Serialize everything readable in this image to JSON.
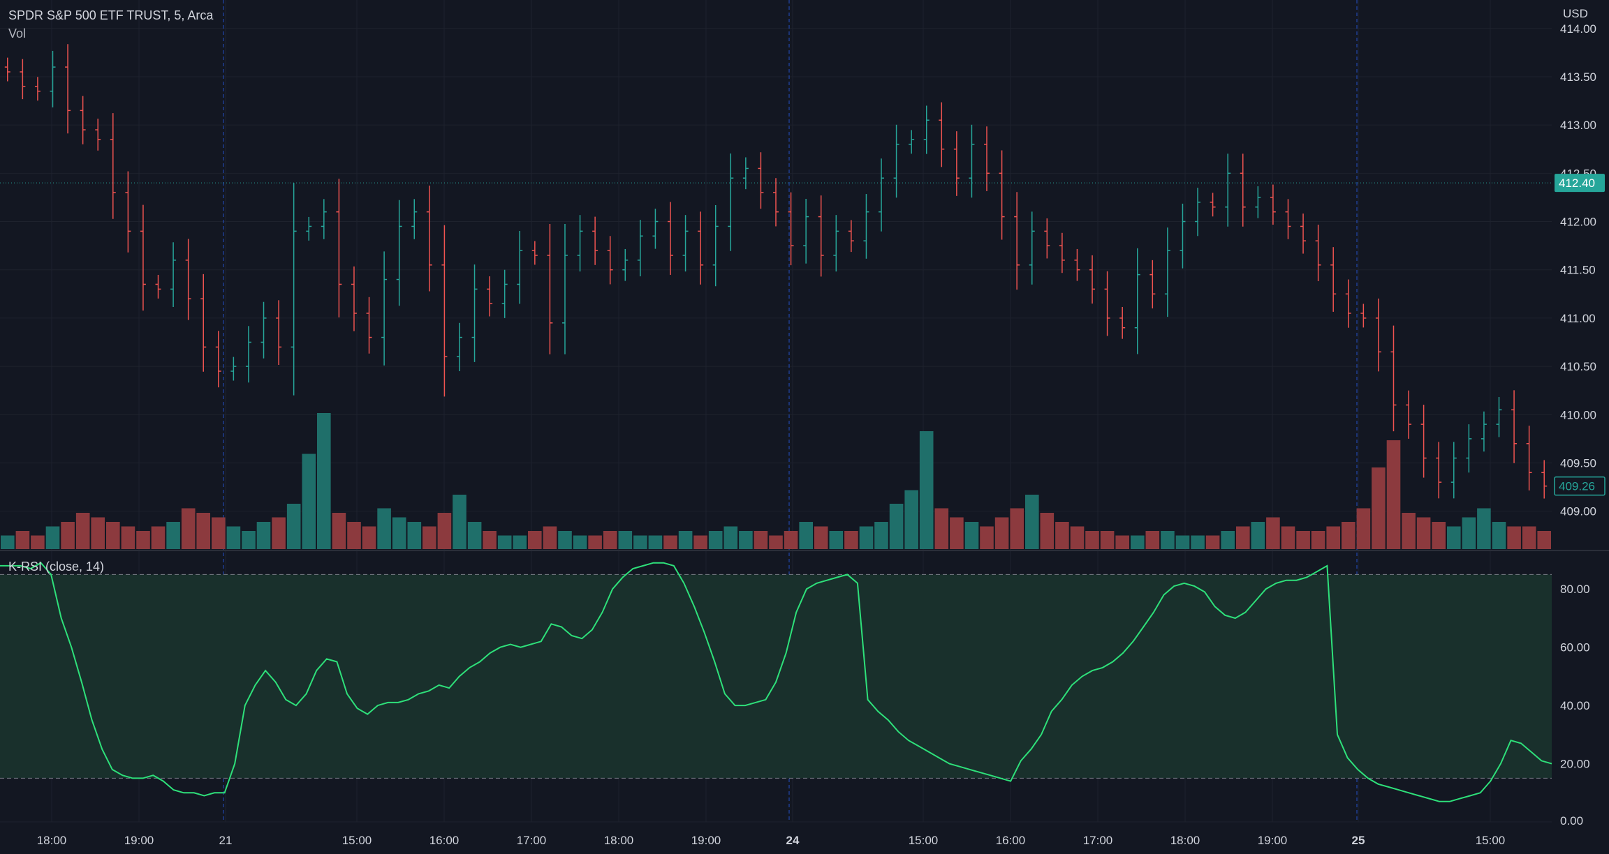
{
  "header": {
    "symbol_title": "SPDR S&P 500 ETF TRUST, 5, Arca",
    "volume_label": "Vol",
    "indicator_label": "K-RSI (close, 14)",
    "currency": "USD"
  },
  "colors": {
    "background": "#131722",
    "grid": "#1e222d",
    "up": "#26a69a",
    "down": "#ef5350",
    "vol_up": "#1f6f6a",
    "vol_down": "#8c3a3e",
    "rsi_line": "#2ee07a",
    "rsi_fill": "#19302c",
    "session_line": "#2962ff",
    "axis_text": "#d1d4dc"
  },
  "chart_data": [
    {
      "type": "ohlc",
      "name": "price",
      "ylim": [
        408.6,
        414.15
      ],
      "y_ticks": [
        "409.00",
        "409.50",
        "410.00",
        "410.50",
        "411.00",
        "411.50",
        "412.00",
        "412.50",
        "413.00",
        "413.50",
        "414.00"
      ],
      "last_price_label": "412.40",
      "last_price_value": 412.4,
      "second_price_label": "409.26",
      "second_price_value": 409.26,
      "close_series": [
        413.55,
        413.4,
        413.35,
        413.6,
        413.15,
        412.95,
        412.85,
        412.3,
        411.9,
        411.35,
        411.3,
        411.6,
        411.2,
        410.7,
        410.45,
        410.5,
        410.75,
        411.0,
        410.7,
        411.9,
        411.95,
        412.1,
        411.35,
        411.05,
        410.8,
        411.4,
        411.95,
        412.1,
        411.55,
        410.6,
        410.8,
        411.3,
        411.15,
        411.35,
        411.7,
        411.65,
        410.95,
        411.65,
        411.9,
        411.7,
        411.5,
        411.6,
        411.85,
        412.0,
        411.65,
        411.9,
        411.55,
        411.95,
        412.45,
        412.55,
        412.3,
        412.1,
        411.75,
        412.05,
        411.65,
        411.9,
        411.8,
        412.1,
        412.45,
        412.8,
        412.85,
        413.05,
        412.75,
        412.45,
        412.8,
        412.5,
        412.05,
        411.55,
        411.9,
        411.75,
        411.6,
        411.5,
        411.3,
        411.0,
        410.9,
        411.45,
        411.25,
        411.7,
        412.0,
        412.2,
        412.15,
        412.5,
        412.15,
        412.25,
        412.1,
        411.95,
        411.8,
        411.55,
        411.25,
        411.05,
        411.0,
        410.65,
        410.1,
        409.9,
        409.55,
        409.3,
        409.55,
        409.75,
        409.9,
        410.05,
        409.7,
        409.4,
        409.26
      ],
      "x_ticks": [
        "18:00",
        "19:00",
        "21",
        "15:00",
        "16:00",
        "17:00",
        "18:00",
        "19:00",
        "24",
        "15:00",
        "16:00",
        "17:00",
        "18:00",
        "19:00",
        "25",
        "15:00"
      ]
    },
    {
      "type": "bar",
      "name": "volume",
      "values": [
        3,
        4,
        3,
        5,
        6,
        8,
        7,
        6,
        5,
        4,
        5,
        6,
        9,
        8,
        7,
        5,
        4,
        6,
        7,
        10,
        21,
        30,
        8,
        6,
        5,
        9,
        7,
        6,
        5,
        8,
        12,
        6,
        4,
        3,
        3,
        4,
        5,
        4,
        3,
        3,
        4,
        4,
        3,
        3,
        3,
        4,
        3,
        4,
        5,
        4,
        4,
        3,
        4,
        6,
        5,
        4,
        4,
        5,
        6,
        10,
        13,
        26,
        9,
        7,
        6,
        5,
        7,
        9,
        12,
        8,
        6,
        5,
        4,
        4,
        3,
        3,
        4,
        4,
        3,
        3,
        3,
        4,
        5,
        6,
        7,
        5,
        4,
        4,
        5,
        6,
        9,
        18,
        24,
        8,
        7,
        6,
        5,
        7,
        9,
        6,
        5,
        5,
        4
      ]
    },
    {
      "type": "line",
      "name": "K-RSI",
      "ylim": [
        0,
        93
      ],
      "y_ticks": [
        "0.00",
        "20.00",
        "40.00",
        "60.00",
        "80.00"
      ],
      "upper_band": 85,
      "lower_band": 15,
      "values": [
        88,
        88,
        88,
        87,
        89,
        85,
        70,
        60,
        48,
        35,
        25,
        18,
        16,
        15,
        15,
        16,
        14,
        11,
        10,
        10,
        9,
        10,
        10,
        20,
        40,
        47,
        52,
        48,
        42,
        40,
        44,
        52,
        56,
        55,
        44,
        39,
        37,
        40,
        41,
        41,
        42,
        44,
        45,
        47,
        46,
        50,
        53,
        55,
        58,
        60,
        61,
        60,
        61,
        62,
        68,
        67,
        64,
        63,
        66,
        72,
        80,
        84,
        87,
        88,
        89,
        89,
        88,
        82,
        74,
        65,
        55,
        44,
        40,
        40,
        41,
        42,
        48,
        58,
        72,
        80,
        82,
        83,
        84,
        85,
        82,
        42,
        38,
        35,
        31,
        28,
        26,
        24,
        22,
        20,
        19,
        18,
        17,
        16,
        15,
        14,
        21,
        25,
        30,
        38,
        42,
        47,
        50,
        52,
        53,
        55,
        58,
        62,
        67,
        72,
        78,
        81,
        82,
        81,
        79,
        74,
        71,
        70,
        72,
        76,
        80,
        82,
        83,
        83,
        84,
        86,
        88,
        30,
        22,
        18,
        15,
        13,
        12,
        11,
        10,
        9,
        8,
        7,
        7,
        8,
        9,
        10,
        14,
        20,
        28,
        27,
        24,
        21,
        20
      ]
    }
  ]
}
